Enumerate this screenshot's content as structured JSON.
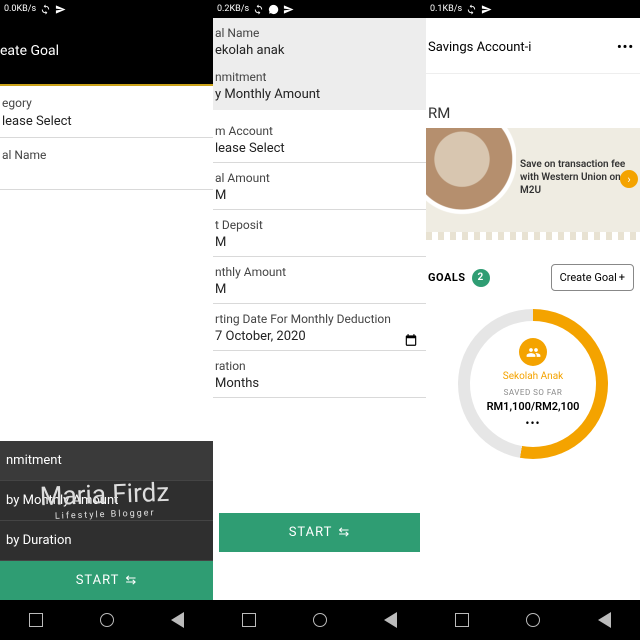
{
  "status": {
    "speed1": "0.0KB/s",
    "speed2": "0.2KB/s",
    "speed3": "0.1KB/s"
  },
  "s1": {
    "title": "eate Goal",
    "category_label": "egory",
    "category_value": "lease Select",
    "goalname_label": "al Name",
    "sheet_header": "nmitment",
    "opt_monthly": "by Monthly Amount",
    "opt_duration": "by Duration",
    "start": "START"
  },
  "s2": {
    "goalname_label": "al Name",
    "goalname_value": "ekolah anak",
    "commitment_label": "nmitment",
    "commitment_value": "y Monthly Amount",
    "from_label": "m Account",
    "from_value": "lease Select",
    "goalamt_label": "al Amount",
    "goalamt_value": "M",
    "deposit_label": "t Deposit",
    "deposit_value": "M",
    "monthly_label": "nthly Amount",
    "monthly_value": "M",
    "date_label": "rting Date For Monthly Deduction",
    "date_value": "7 October,  2020",
    "duration_label": "ration",
    "duration_value": " Months",
    "start": "START"
  },
  "s3": {
    "account": "Savings Account-i",
    "currency": "RM",
    "promo": "Save on transaction fee with Western Union on M2U",
    "goals_label": "GOALS",
    "goals_count": "2",
    "create_label": "Create Goal",
    "goal_name": "Sekolah Anak",
    "saved_label": "SAVED SO FAR",
    "saved_amount": "RM1,100/RM2,100"
  },
  "watermark": {
    "name": "Maria Firdz",
    "tag": "Lifestyle Blogger"
  }
}
